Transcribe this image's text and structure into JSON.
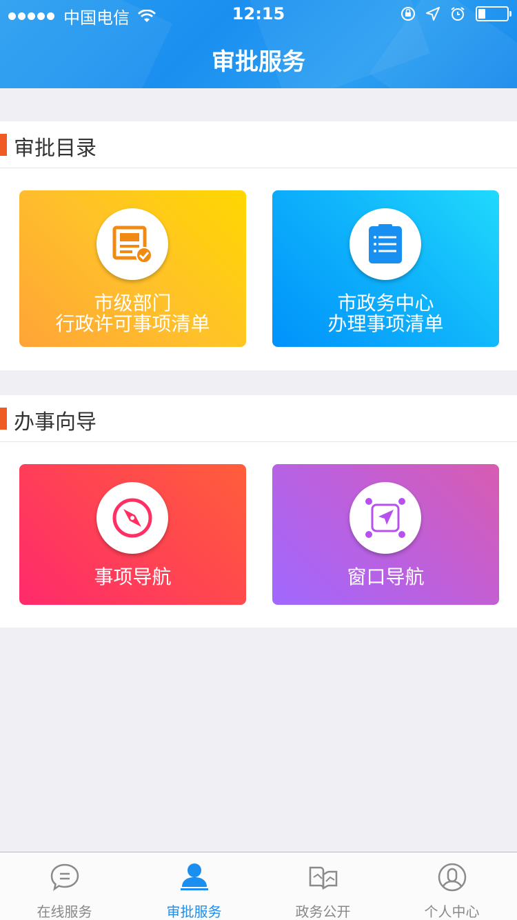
{
  "status_bar": {
    "carrier": "中国电信",
    "time": "12:15"
  },
  "nav": {
    "title": "审批服务"
  },
  "sections": [
    {
      "title": "审批目录",
      "cards": [
        {
          "line1": "市级部门",
          "line2": "行政许可事项清单",
          "icon": "document-check-icon",
          "color": "#ffb52f"
        },
        {
          "line1": "市政务中心",
          "line2": "办理事项清单",
          "icon": "clipboard-list-icon",
          "color": "#10a8fb"
        }
      ]
    },
    {
      "title": "办事向导",
      "cards": [
        {
          "line1": "事项导航",
          "icon": "compass-icon",
          "color": "#ff3a5a"
        },
        {
          "line1": "窗口导航",
          "icon": "location-arrow-icon",
          "color": "#c060e0"
        }
      ]
    }
  ],
  "tabs": [
    {
      "label": "在线服务",
      "icon": "chat-bubble-icon",
      "active": false
    },
    {
      "label": "审批服务",
      "icon": "person-stamp-icon",
      "active": true
    },
    {
      "label": "政务公开",
      "icon": "open-book-icon",
      "active": false
    },
    {
      "label": "个人中心",
      "icon": "user-circle-icon",
      "active": false
    }
  ],
  "colors": {
    "accent": "#1a8ff0",
    "section_marker": "#f05a23",
    "background": "#efeff4"
  }
}
